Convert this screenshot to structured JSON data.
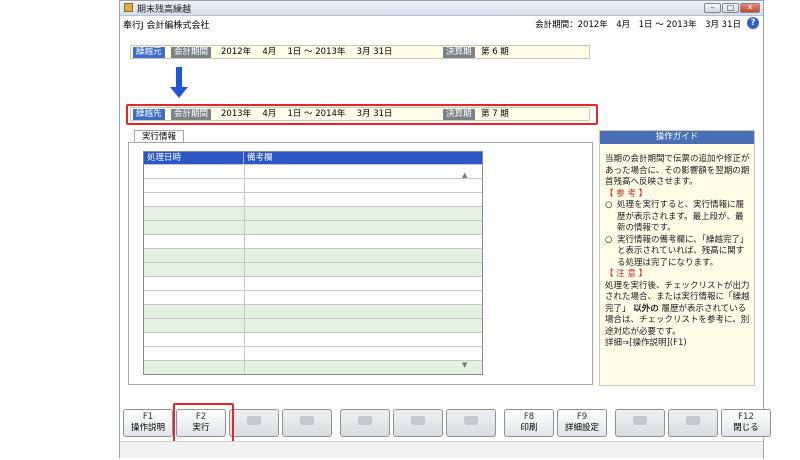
{
  "window": {
    "title": "期末残高繰越",
    "buttons": {
      "minimize": "–",
      "maximize": "□",
      "close": "✕"
    }
  },
  "header": {
    "company": "奉行J 会計編株式会社",
    "period_text": "会計期間：2012年　4月　1日 ～ 2013年　3月 31日"
  },
  "source": {
    "tag": "繰越元",
    "period_label": "会計期間",
    "period": "2012年　 4月　 1日 ～ 2013年　 3月 31日",
    "term_label": "決算期",
    "term": "第 6 期"
  },
  "destination": {
    "tag": "繰越先",
    "period_label": "会計期間",
    "period": "2013年　 4月　 1日 ～ 2014年　 3月 31日",
    "term_label": "決算期",
    "term": "第 7 期"
  },
  "exec_tab": {
    "label": "実行情報",
    "columns": [
      "処理日時",
      "備考欄"
    ],
    "row_count": 15
  },
  "guide": {
    "title": "操作ガイド",
    "intro": "当期の会計期間で伝票の追加や修正があった場合に、その影響額を翌期の期首残高へ反映させます。",
    "ref_heading": "【 参 考 】",
    "ref_items": [
      "処理を実行すると、実行情報に履歴が表示されます。最上段が、最新の情報です。",
      "実行情報の備考欄に、「繰越完了」と表示されていれば、残高に関する処理は完了になります。"
    ],
    "note_heading": "【 注 意 】",
    "note_text_1": "処理を実行後、チェックリストが出力された場合、または実行情報に「繰越完了」",
    "note_bold": "以外の",
    "note_text_2": "履歴が表示されている場合は、チェックリストを参考に、別途対応が必要です。",
    "detail_link": "詳細⇒[操作説明](F1)"
  },
  "fkeys": [
    {
      "key": "F1",
      "label": "操作説明",
      "enabled": true
    },
    {
      "key": "F2",
      "label": "実行",
      "enabled": true
    },
    {
      "key": "F3",
      "label": "",
      "enabled": false
    },
    {
      "key": "F4",
      "label": "",
      "enabled": false
    },
    {
      "key": "F5",
      "label": "",
      "enabled": false
    },
    {
      "key": "F6",
      "label": "",
      "enabled": false
    },
    {
      "key": "F7",
      "label": "",
      "enabled": false
    },
    {
      "key": "F8",
      "label": "印刷",
      "enabled": true
    },
    {
      "key": "F9",
      "label": "詳細設定",
      "enabled": true
    },
    {
      "key": "F10",
      "label": "",
      "enabled": false
    },
    {
      "key": "F11",
      "label": "",
      "enabled": false
    },
    {
      "key": "F12",
      "label": "閉じる",
      "enabled": true
    }
  ],
  "colors": {
    "highlight": "#e1272b",
    "arrow": "#1f56d8",
    "grid_header": "#2b56c6",
    "row_alt": "#e3f2e0",
    "guide_title": "#4a6fb5"
  }
}
